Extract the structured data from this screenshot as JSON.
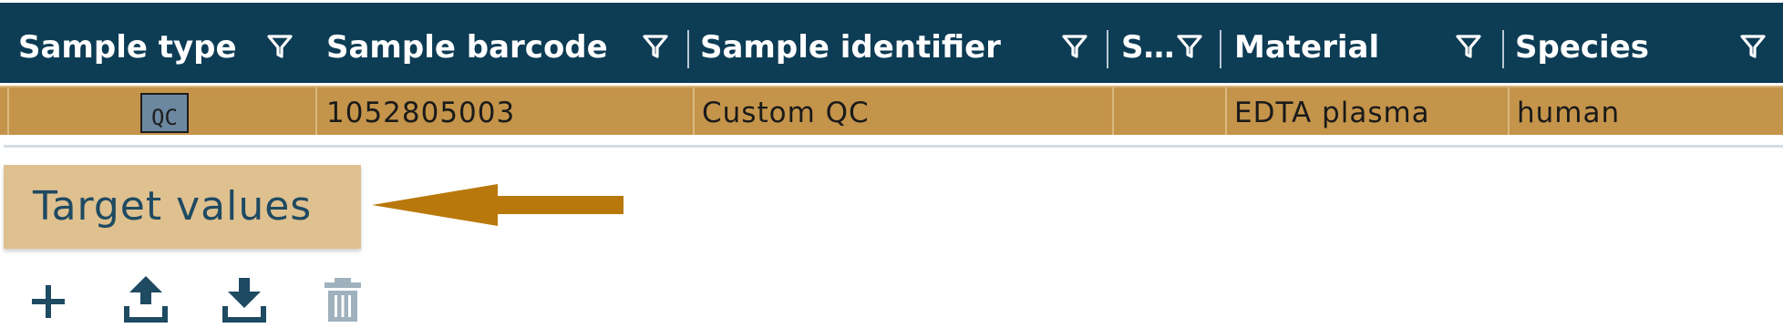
{
  "grid": {
    "columns": [
      {
        "label": "Sample type"
      },
      {
        "label": "Sample barcode"
      },
      {
        "label": "Sample identifier"
      },
      {
        "label": "S…"
      },
      {
        "label": "Material"
      },
      {
        "label": "Species"
      }
    ],
    "row": {
      "sample_type": "QC",
      "sample_barcode": "1052805003",
      "sample_identifier": "Custom QC",
      "s": "",
      "material": "EDTA plasma",
      "species": "human"
    }
  },
  "target_values": {
    "label": "Target values"
  },
  "toolbar": {
    "icons": [
      "add-icon",
      "upload-icon",
      "download-icon",
      "delete-icon"
    ]
  },
  "colors": {
    "header_bg": "#0d3c55",
    "row_selected_bg": "#c4944a",
    "button_bg": "#dfc08f",
    "arrow": "#b8780b",
    "icon": "#1e4a62",
    "icon_disabled": "#9fb1bd"
  }
}
